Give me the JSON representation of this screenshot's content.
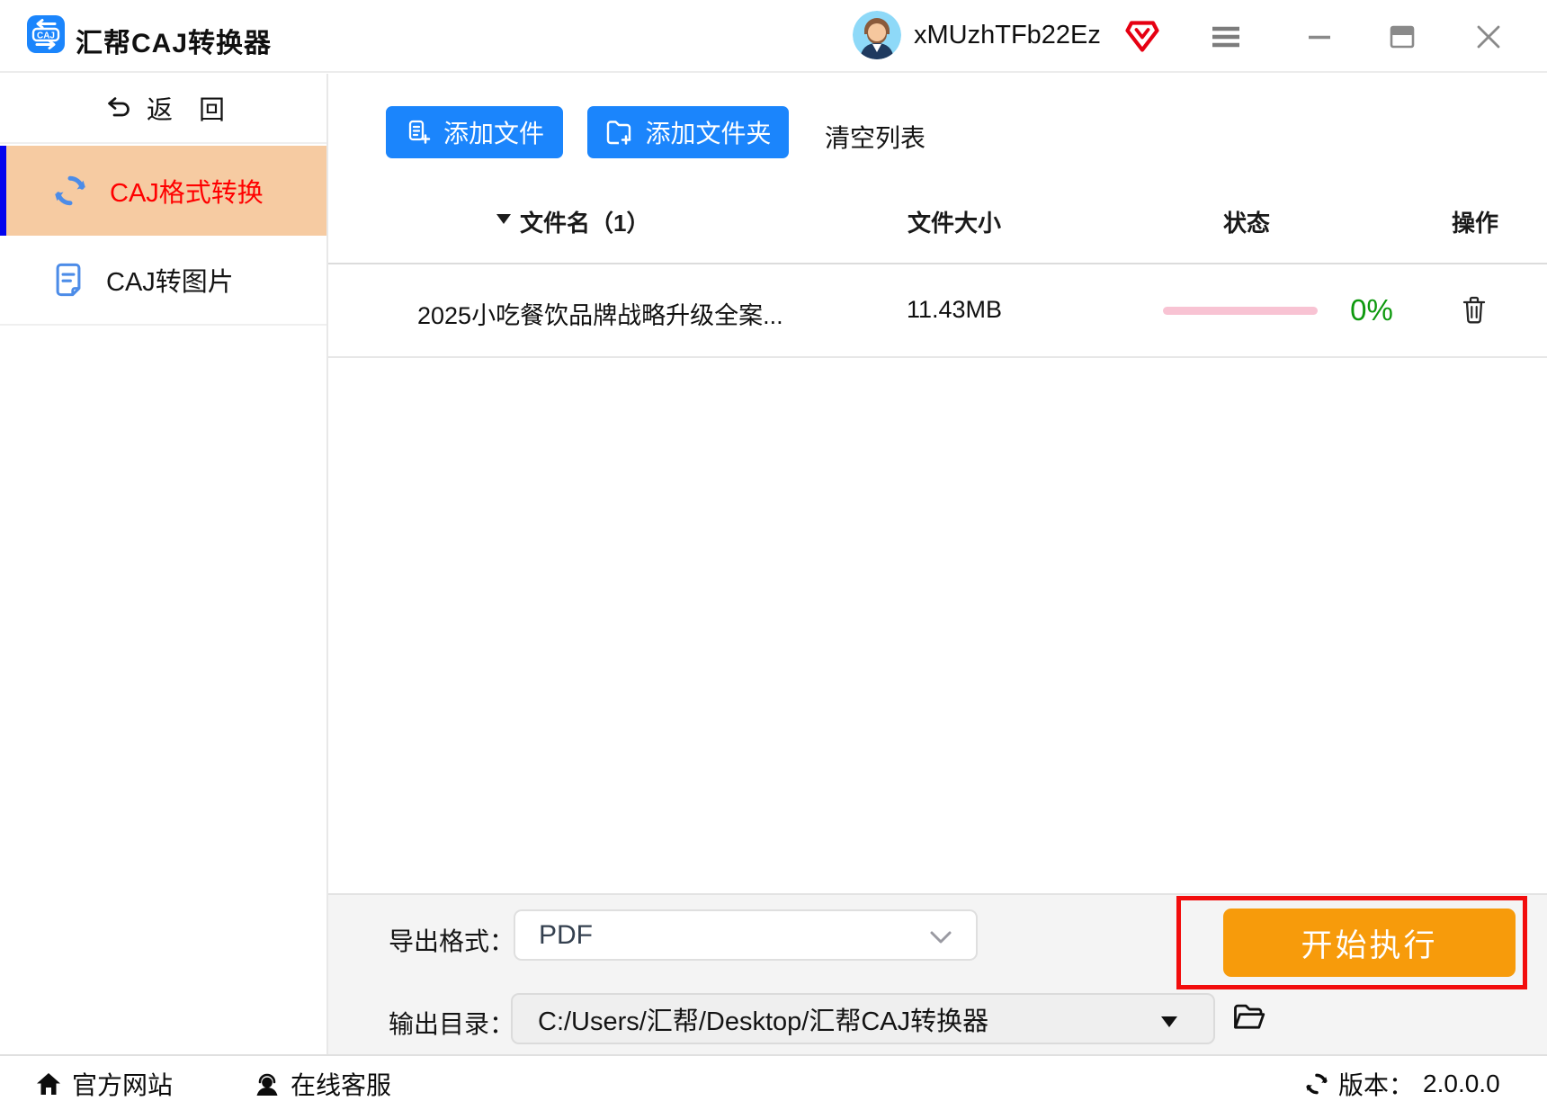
{
  "titlebar": {
    "app_title": "汇帮CAJ转换器",
    "app_icon_text": "CAJ",
    "username": "xMUzhTFb22Ez"
  },
  "sidebar": {
    "back_label": "返　回",
    "items": [
      {
        "label": "CAJ格式转换",
        "selected": true
      },
      {
        "label": "CAJ转图片",
        "selected": false
      }
    ]
  },
  "toolbar": {
    "add_file": "添加文件",
    "add_folder": "添加文件夹",
    "clear_list": "清空列表"
  },
  "table": {
    "headers": {
      "name": "文件名（1）",
      "size": "文件大小",
      "status": "状态",
      "action": "操作"
    },
    "rows": [
      {
        "name": "2025小吃餐饮品牌战略升级全案...",
        "size": "11.43MB",
        "progress_percent": 0,
        "percent_label": "0%"
      }
    ]
  },
  "panel": {
    "export_label": "导出格式：",
    "export_value": "PDF",
    "output_label": "输出目录：",
    "output_value": "C:/Users/汇帮/Desktop/汇帮CAJ转换器",
    "start_label": "开始执行"
  },
  "statusbar": {
    "website": "官方网站",
    "support": "在线客服",
    "version_label": "版本：",
    "version_value": "2.0.0.0"
  },
  "colors": {
    "accent_blue": "#1b85fc",
    "sidebar_selected_bg": "#f6cba2",
    "sidebar_selected_text": "#ff0000",
    "sidebar_selected_bar": "#0404ee",
    "progress_pink": "#f8c3d3",
    "percent_green": "#0e990e",
    "start_orange": "#f79b0b",
    "annotation_red": "#f20d0d",
    "vip_red": "#e60012"
  }
}
